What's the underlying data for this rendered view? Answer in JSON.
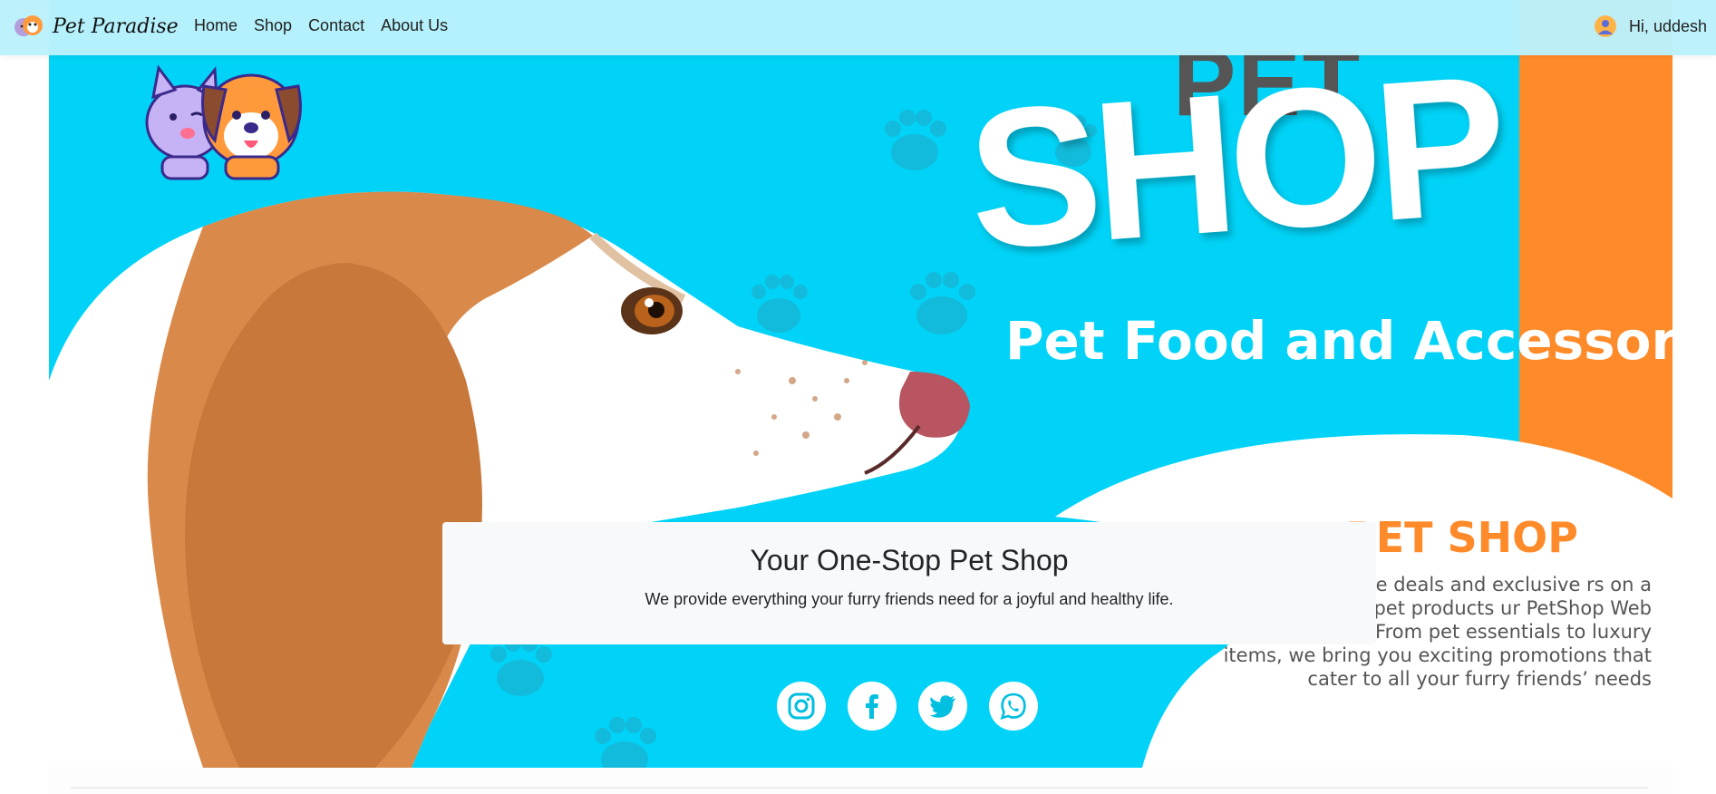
{
  "navbar": {
    "brand_name": "Pet Paradise",
    "links": [
      {
        "label": "Home"
      },
      {
        "label": "Shop"
      },
      {
        "label": "Contact"
      },
      {
        "label": "About Us"
      }
    ],
    "greeting": "Hi, uddesh"
  },
  "hero": {
    "pet_word": "PET",
    "shop_word": "SHOP",
    "tagline": "Pet Food and Accessories",
    "sub_title": "PET SHOP",
    "blurb": "ce unbeatable deals and exclusive rs on a wide range of pet products ur PetShop Web Application. From pet essentials to luxury items, we bring you exciting promotions that cater to all your furry friends’ needs"
  },
  "card": {
    "heading": "Your One-Stop Pet Shop",
    "text": "We provide everything your furry friends need for a joyful and healthy life."
  },
  "socials": [
    "instagram-icon",
    "facebook-icon",
    "twitter-icon",
    "whatsapp-icon"
  ],
  "colors": {
    "navbar_bg": "#bbf2fc",
    "hero_bg": "#00d3f7",
    "accent_orange": "#ff8a29",
    "card_bg": "#f8f9fa"
  }
}
